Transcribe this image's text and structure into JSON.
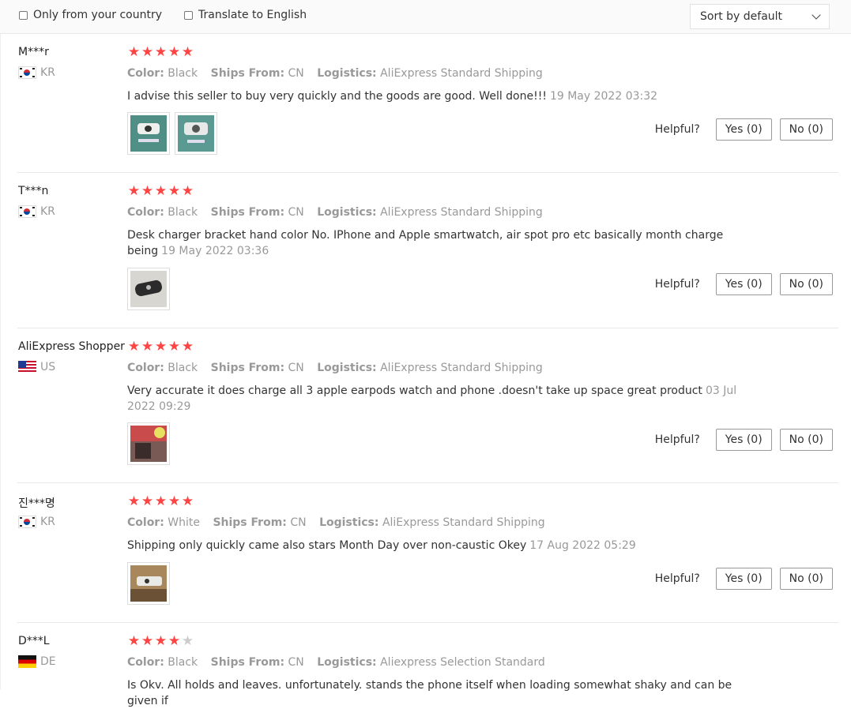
{
  "filters": {
    "only_country": "Only from your country",
    "translate": "Translate to English",
    "sort": "Sort by default"
  },
  "labels": {
    "color": "Color:",
    "ships_from": "Ships From:",
    "logistics": "Logistics:",
    "helpful": "Helpful?"
  },
  "reviews": [
    {
      "user": "M***r",
      "country": "KR",
      "rating": 5,
      "color": "Black",
      "ships_from": "CN",
      "logistics": "AliExpress Standard Shipping",
      "text": "I advise this seller to buy very quickly and the goods are good. Well done!!!",
      "date": "19 May 2022 03:32",
      "yes": "Yes (0)",
      "no": "No (0)"
    },
    {
      "user": "T***n",
      "country": "KR",
      "rating": 5,
      "color": "Black",
      "ships_from": "CN",
      "logistics": "AliExpress Standard Shipping",
      "text": "Desk charger bracket hand color No. IPhone and Apple smartwatch, air spot pro etc basically month charge being",
      "date": "19 May 2022 03:36",
      "yes": "Yes (0)",
      "no": "No (0)"
    },
    {
      "user": "AliExpress Shopper",
      "country": "US",
      "rating": 5,
      "color": "Black",
      "ships_from": "CN",
      "logistics": "AliExpress Standard Shipping",
      "text": "Very accurate it does charge all 3 apple earpods watch and phone .doesn't take up space great product",
      "date": "03 Jul 2022 09:29",
      "yes": "Yes (0)",
      "no": "No (0)"
    },
    {
      "user": "진***명",
      "country": "KR",
      "rating": 5,
      "color": "White",
      "ships_from": "CN",
      "logistics": "AliExpress Standard Shipping",
      "text": "Shipping only quickly came also stars Month Day over non-caustic Okey",
      "date": "17 Aug 2022 05:29",
      "yes": "Yes (0)",
      "no": "No (0)"
    },
    {
      "user": "D***L",
      "country": "DE",
      "rating": 4,
      "color": "Black",
      "ships_from": "CN",
      "logistics": "Aliexpress Selection Standard",
      "text": "Is Okv. All holds and leaves. unfortunately. stands the phone itself when loading somewhat shaky and can be given if",
      "date": ""
    }
  ],
  "colors": {
    "star": "#ff4444",
    "star_off": "#cccccc",
    "muted": "#999999"
  }
}
